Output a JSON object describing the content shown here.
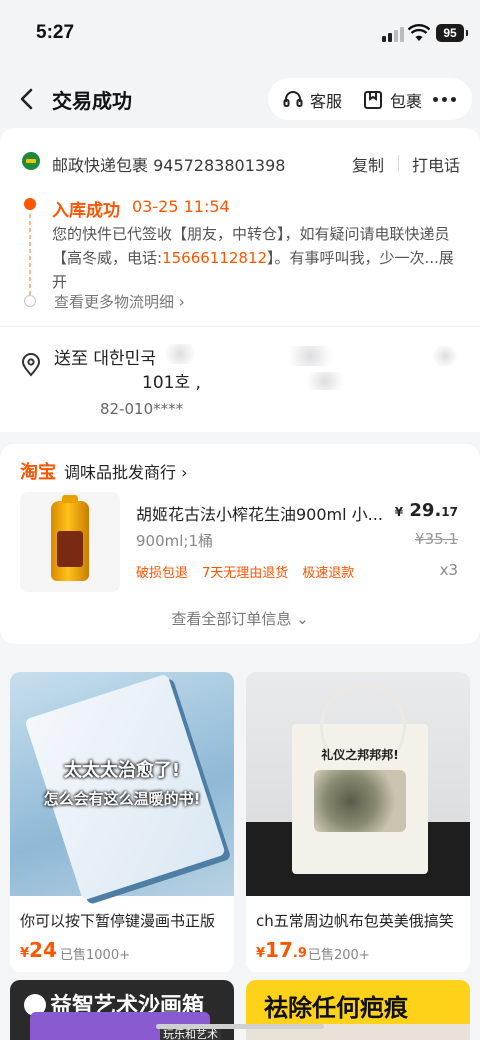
{
  "status_bar": {
    "time": "5:27",
    "battery": "95"
  },
  "header": {
    "title": "交易成功",
    "service_label": "客服",
    "package_label": "包裹"
  },
  "logistics": {
    "carrier_tracking": "邮政快递包裹 9457283801398",
    "copy_label": "复制",
    "call_label": "打电话",
    "status": "入库成功",
    "status_time": "03-25 11:54",
    "desc_part1": "您的快件已代签收【朋友，中转仓】，如有疑问请电联快递员【高冬威，电话:",
    "phone": "15666112812",
    "desc_part2": "】。有事呼叫我，少一次...展开",
    "more_label": "查看更多物流明细"
  },
  "address": {
    "line1": "送至 대한민국",
    "line2": "101호 ,",
    "line3": "82-010****",
    "line2_trail": ","
  },
  "order": {
    "shop_logo": "淘宝",
    "shop_name": "调味品批发商行",
    "product_name": "胡姬花古法小榨花生油900ml 小...",
    "price_symbol": "¥",
    "price_int": "29.",
    "price_dec": "17",
    "original_price": "¥35.1",
    "sku": "900ml;1桶",
    "tags": [
      "破损包退",
      "7天无理由退货",
      "极速退款"
    ],
    "quantity": "x3",
    "view_all": "查看全部订单信息"
  },
  "recommendations": [
    {
      "title": "你可以按下暂停键漫画书正版",
      "price_symbol": "¥",
      "price": "24",
      "sold": "已售1000+",
      "overlay_line1": "太太太治愈了!",
      "overlay_line2": "怎么会有这么温暖的书!"
    },
    {
      "title": "ch五常周边帆布包英美俄搞笑",
      "price_symbol": "¥",
      "price": "17",
      "price_dec": ".9",
      "sold": "已售200+",
      "overlay_line1": "礼仪之邦邦邦!"
    }
  ],
  "bottom_cards": [
    {
      "text": "益智艺术沙画箱",
      "sub": "玩乐和艺术"
    },
    {
      "text": "祛除任何疤痕"
    }
  ],
  "colors": {
    "accent": "#ff5500",
    "background": "#f4f5f7"
  }
}
